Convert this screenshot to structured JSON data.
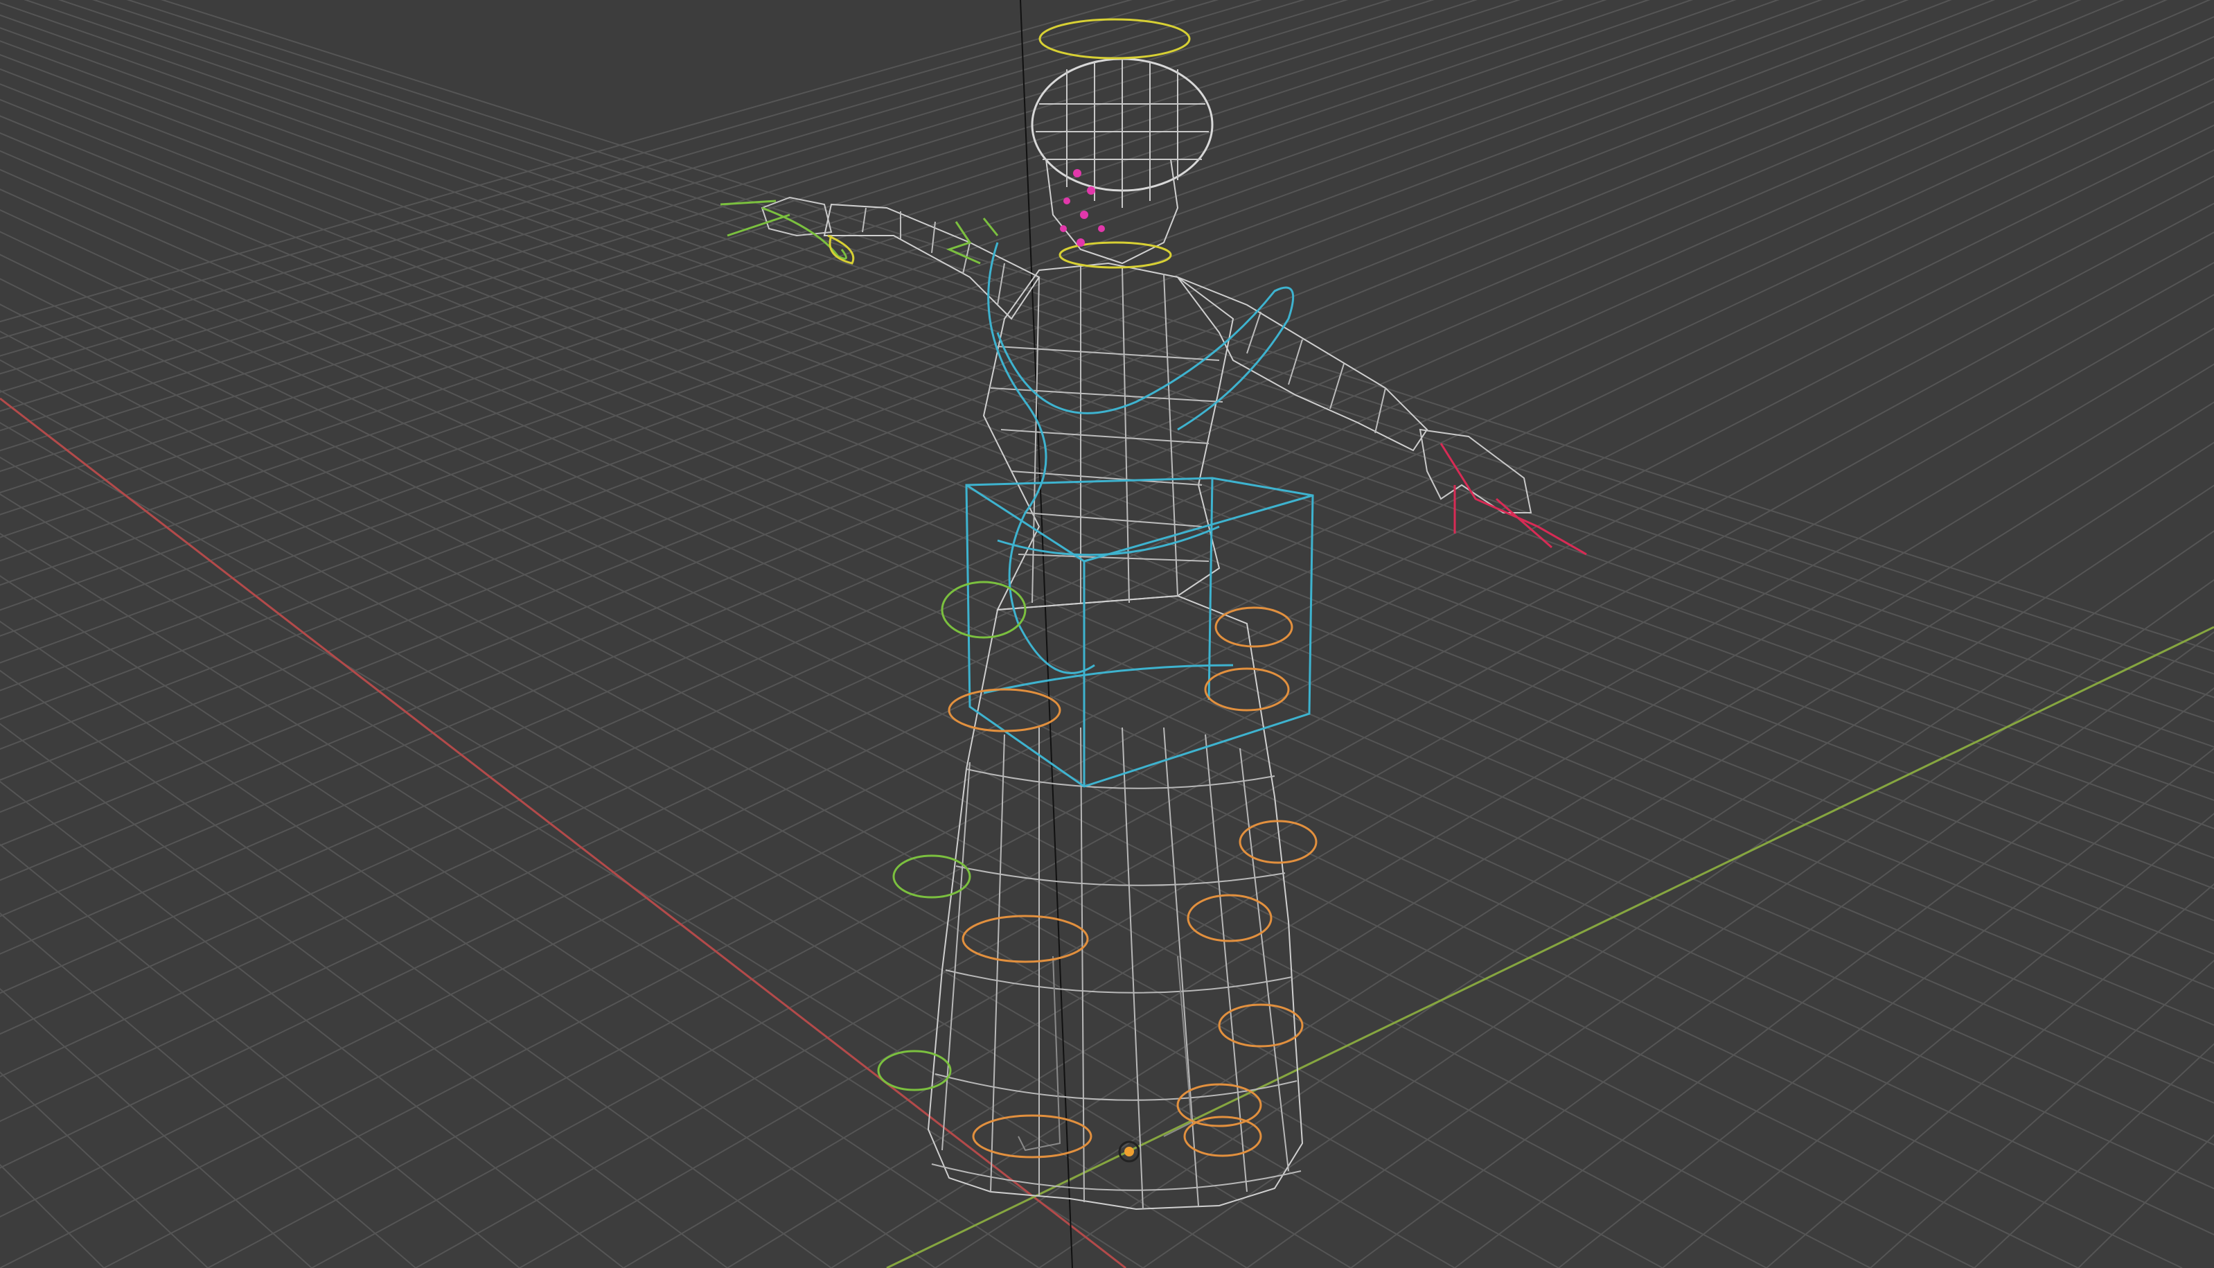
{
  "viewport": {
    "mode": "wireframe",
    "shading": "wireframe",
    "overlays": [
      "floor-grid",
      "x-axis",
      "y-axis",
      "armature-controls",
      "3d-cursor"
    ],
    "colors": {
      "background": "#3d3d3d",
      "grid_line": "#555555",
      "x_axis": "#b34a4a",
      "y_axis": "#86a640",
      "z_axis": "#111111",
      "wire": "#d0d0d0",
      "control_cyan": "#3eb3cf",
      "control_orange": "#e2903e",
      "control_green": "#7bc03f",
      "control_yellow": "#d7d034",
      "control_red": "#d82b55",
      "control_magenta": "#e238ab",
      "cursor": "#f0a030"
    }
  },
  "scene": {
    "object": "character-rig",
    "character_pose": "t-pose",
    "icons": [
      "3d-cursor-icon"
    ]
  }
}
